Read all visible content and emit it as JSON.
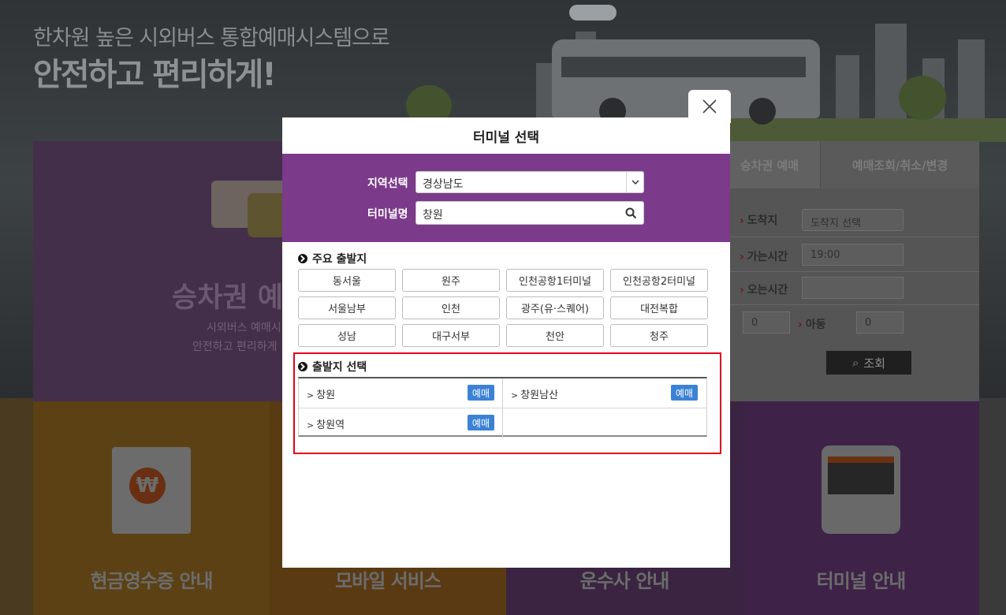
{
  "background": {
    "hero_subtitle": "한차원 높은 시외버스 통합예매시스템으로",
    "hero_title": "안전하고 편리하게!",
    "purple_panel": {
      "title": "승차권 예",
      "line1": "시외버스 예매시",
      "line2": "안전하고 편리하게"
    },
    "search_panel": {
      "tabs": [
        "승차권 예매",
        "예매조회/취소/변경"
      ],
      "arrival_label": "도착지",
      "arrival_placeholder": "도착지 선택",
      "depart_time_label": "가는시간",
      "depart_time_value": "19:00",
      "return_time_label": "오는시간",
      "adult_value": "0",
      "child_label": "아동",
      "child_value": "0",
      "search_button": "조회"
    },
    "bottom_tiles": [
      "현금영수증 안내",
      "모바일 서비스",
      "운수사 안내",
      "터미널 안내"
    ],
    "won_symbol": "₩"
  },
  "modal": {
    "title": "터미널 선택",
    "filter": {
      "region_label": "지역선택",
      "region_value": "경상남도",
      "terminal_label": "터미널명",
      "terminal_value": "창원"
    },
    "major_section_title": "주요 출발지",
    "major_terminals": [
      "동서울",
      "원주",
      "인천공항1터미널",
      "인천공항2터미널",
      "서울남부",
      "인천",
      "광주(유·스퀘어)",
      "대전복합",
      "성남",
      "대구서부",
      "천안",
      "청주"
    ],
    "departure_section_title": "출발지 선택",
    "departures": [
      {
        "name": "창원",
        "button": "예매"
      },
      {
        "name": "창원남산",
        "button": "예매"
      },
      {
        "name": "창원역",
        "button": "예매"
      }
    ]
  },
  "colors": {
    "modal_header_purple": "#7b3a8a",
    "reserve_button_blue": "#3b82d6",
    "highlight_red": "#e3001b"
  }
}
